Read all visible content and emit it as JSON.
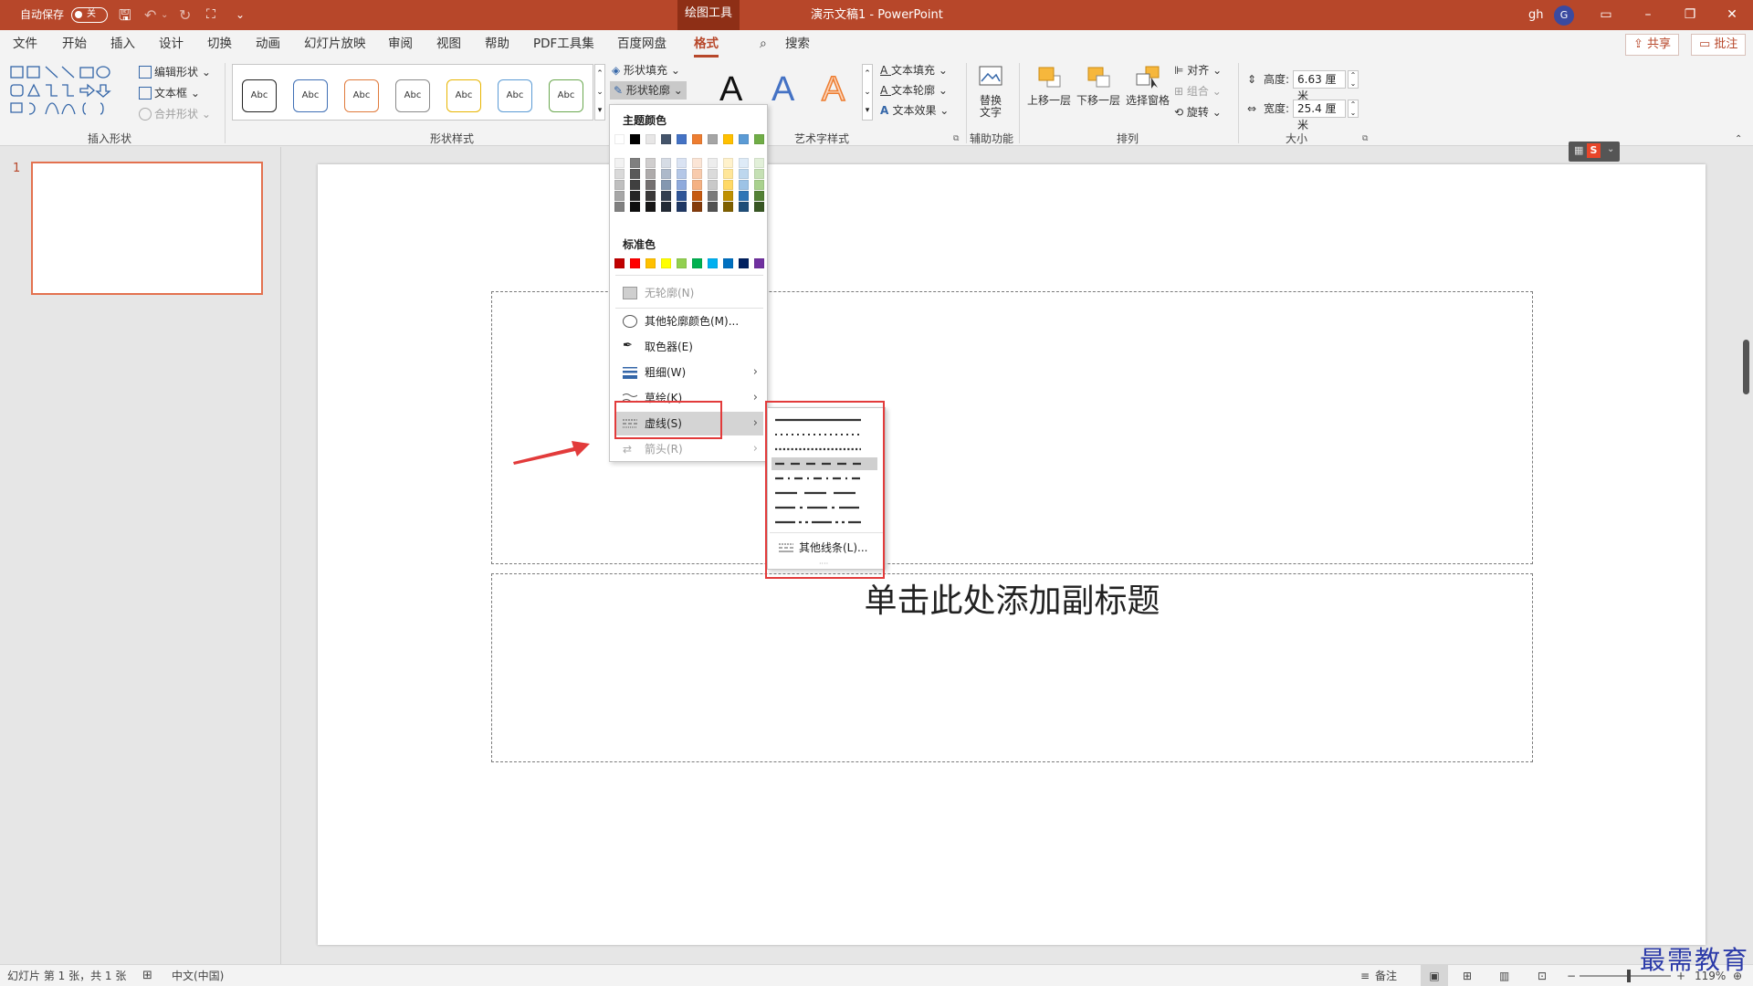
{
  "titlebar": {
    "autosave_label": "自动保存",
    "autosave_state": "关",
    "context_tab": "绘图工具",
    "doc_title": "演示文稿1  -  PowerPoint",
    "user": "gh",
    "avatar": "G"
  },
  "tabs": [
    "文件",
    "开始",
    "插入",
    "设计",
    "切换",
    "动画",
    "幻灯片放映",
    "审阅",
    "视图",
    "帮助",
    "PDF工具集",
    "百度网盘",
    "格式"
  ],
  "search_label": "搜索",
  "share_label": "共享",
  "comment_label": "批注",
  "ribbon": {
    "insert_shapes": {
      "edit_shape": "编辑形状",
      "text_box": "文本框",
      "merge_shapes": "合并形状",
      "label": "插入形状"
    },
    "shape_styles": {
      "sample": "Abc",
      "fill": "形状填充",
      "outline": "形状轮廓",
      "label": "形状样式",
      "style_colors": [
        "#222222",
        "#3f6fb5",
        "#e07a3b",
        "#8a8a8a",
        "#e8b500",
        "#5b9bd5",
        "#6aa84f"
      ]
    },
    "wordart": {
      "glyph": "A",
      "text_fill": "文本填充",
      "text_outline": "文本轮廓",
      "text_effect": "文本效果",
      "label": "艺术字样式"
    },
    "accessibility": {
      "alt_text_line1": "替换",
      "alt_text_line2": "文字",
      "label": "辅助功能"
    },
    "arrange": {
      "bring_forward": "上移一层",
      "send_backward": "下移一层",
      "selection_pane": "选择窗格",
      "align": "对齐",
      "group": "组合",
      "rotate": "旋转",
      "label": "排列"
    },
    "size": {
      "height_label": "高度:",
      "height_value": "6.63 厘米",
      "width_label": "宽度:",
      "width_value": "25.4 厘米",
      "label": "大小"
    }
  },
  "slides_pane": {
    "slide_number": "1"
  },
  "slide": {
    "subtitle_placeholder": "单击此处添加副标题"
  },
  "outline_menu": {
    "theme_colors_label": "主题颜色",
    "theme_colors": [
      "#ffffff",
      "#000000",
      "#e7e6e6",
      "#44546a",
      "#4472c4",
      "#ed7d31",
      "#a5a5a5",
      "#ffc000",
      "#5b9bd5",
      "#70ad47"
    ],
    "theme_shades": [
      [
        "#f2f2f2",
        "#7f7f7f",
        "#d0cece",
        "#d6dce5",
        "#dae3f3",
        "#fbe5d6",
        "#ededed",
        "#fff2cc",
        "#deebf7",
        "#e2f0d9"
      ],
      [
        "#d9d9d9",
        "#595959",
        "#aeabab",
        "#adb9ca",
        "#b4c7e7",
        "#f8cbad",
        "#dbdbdb",
        "#ffe699",
        "#bdd7ee",
        "#c5e0b4"
      ],
      [
        "#bfbfbf",
        "#404040",
        "#757171",
        "#8497b0",
        "#8faadc",
        "#f4b183",
        "#c9c9c9",
        "#ffd966",
        "#9dc3e6",
        "#a9d18e"
      ],
      [
        "#a6a6a6",
        "#262626",
        "#3a3838",
        "#333f50",
        "#2f5597",
        "#c55a11",
        "#7b7b7b",
        "#bf9000",
        "#2e75b6",
        "#538135"
      ],
      [
        "#808080",
        "#0d0d0d",
        "#171616",
        "#222a35",
        "#1f3864",
        "#843c0c",
        "#525252",
        "#7f6000",
        "#1f4e79",
        "#385723"
      ]
    ],
    "standard_colors_label": "标准色",
    "standard_colors": [
      "#c00000",
      "#ff0000",
      "#ffc000",
      "#ffff00",
      "#92d050",
      "#00b050",
      "#00b0f0",
      "#0070c0",
      "#002060",
      "#7030a0"
    ],
    "no_outline": "无轮廓(N)",
    "more_colors": "其他轮廓颜色(M)...",
    "eyedropper": "取色器(E)",
    "weight": "粗细(W)",
    "sketched": "草绘(K)",
    "dashes": "虚线(S)",
    "arrows": "箭头(R)"
  },
  "dash_menu": {
    "more_lines": "其他线条(L)..."
  },
  "statusbar": {
    "slide_info": "幻灯片 第 1 张，共 1 张",
    "language": "中文(中国)",
    "notes": "备注",
    "zoom": "119%"
  },
  "watermark": "最需教育"
}
